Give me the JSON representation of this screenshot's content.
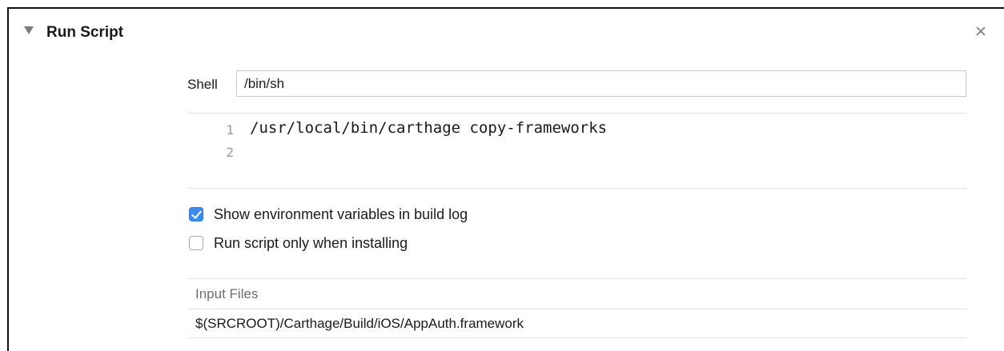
{
  "phase": {
    "title": "Run Script",
    "disclosure_icon": "disclosure-triangle-expanded",
    "close_icon": "close-x"
  },
  "shell": {
    "label": "Shell",
    "value": "/bin/sh"
  },
  "script": {
    "lines": [
      {
        "number": "1",
        "text": "/usr/local/bin/carthage copy-frameworks"
      },
      {
        "number": "2",
        "text": ""
      }
    ]
  },
  "options": {
    "show_env": {
      "label": "Show environment variables in build log",
      "checked": true
    },
    "run_only_installing": {
      "label": "Run script only when installing",
      "checked": false
    }
  },
  "input_files": {
    "header": "Input Files",
    "rows": [
      "$(SRCROOT)/Carthage/Build/iOS/AppAuth.framework"
    ]
  },
  "colors": {
    "checkbox_accent": "#3b8bf0"
  }
}
